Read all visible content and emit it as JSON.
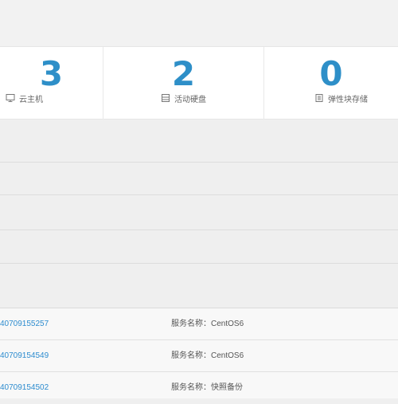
{
  "stats": [
    {
      "value": "3",
      "label": "云主机",
      "icon": "monitor-icon"
    },
    {
      "value": "2",
      "label": "活动硬盘",
      "icon": "disk-icon"
    },
    {
      "value": "0",
      "label": "弹性块存储",
      "icon": "storage-icon"
    }
  ],
  "rows": [
    {
      "id": "40709155257",
      "service": "服务名称：CentOS6"
    },
    {
      "id": "40709154549",
      "service": "服务名称：CentOS6"
    },
    {
      "id": "40709154502",
      "service": "服务名称：快照备份"
    }
  ],
  "colors": {
    "accent": "#2e8fc8",
    "link": "#2d8ccf",
    "background": "#efefef",
    "card": "#ffffff"
  }
}
